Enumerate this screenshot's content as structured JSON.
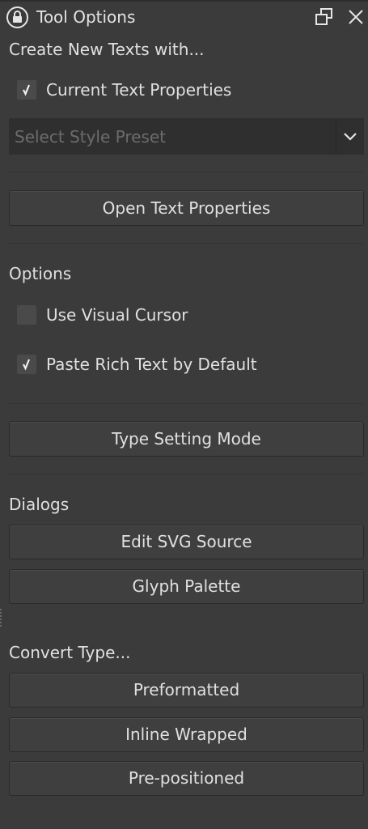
{
  "panel": {
    "title": "Tool Options"
  },
  "create_section": {
    "label": "Create New Texts with...",
    "current_text_properties": {
      "label": "Current Text Properties",
      "checked": true
    },
    "style_preset": {
      "placeholder": "Select Style Preset"
    },
    "open_text_properties_button": "Open Text Properties"
  },
  "options_section": {
    "label": "Options",
    "use_visual_cursor": {
      "label": "Use Visual Cursor",
      "checked": false
    },
    "paste_rich_text": {
      "label": "Paste Rich Text by Default",
      "checked": true
    },
    "type_setting_mode_button": "Type Setting Mode"
  },
  "dialogs_section": {
    "label": "Dialogs",
    "edit_svg_source_button": "Edit SVG Source",
    "glyph_palette_button": "Glyph Palette"
  },
  "convert_section": {
    "label": "Convert Type...",
    "preformatted_button": "Preformatted",
    "inline_wrapped_button": "Inline Wrapped",
    "pre_positioned_button": "Pre-positioned"
  },
  "icons": {
    "lock": "lock-icon",
    "float": "float-window-icon",
    "close": "close-icon",
    "checkmark": "checkmark-icon",
    "dropdown": "chevron-down-icon"
  },
  "colors": {
    "background": "#3b3b3b",
    "combo_background": "#2f2f2f",
    "button_background": "#3f3f3f",
    "text": "#e0e0e0",
    "placeholder_text": "#6c6c6c"
  }
}
